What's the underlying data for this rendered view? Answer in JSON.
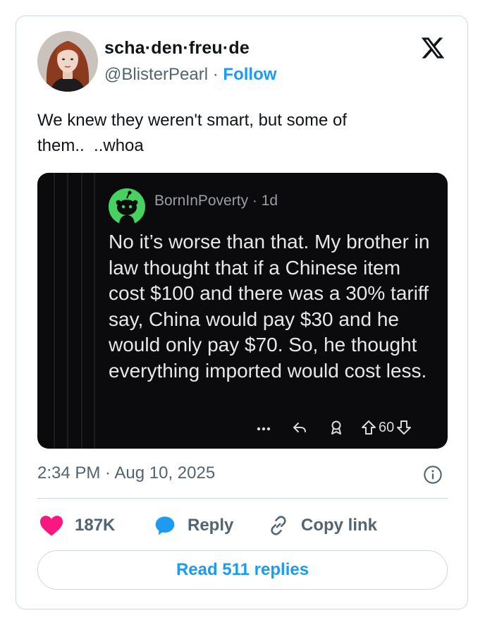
{
  "author": {
    "display_name": "scha·den·freu·de",
    "handle": "@BlisterPearl",
    "separator": "·",
    "follow_label": "Follow"
  },
  "tweet": {
    "text": "We knew they weren't smart, but some of\nthem..  ..whoa",
    "timestamp": "2:34 PM · Aug 10, 2025"
  },
  "embedded_post": {
    "username": "BornInPoverty",
    "age": "· 1d",
    "body": "No it’s worse than that. My brother in law thought that if a Chinese item cost $100 and there was a 30% tariff say, China would pay $30 and he would only pay $70. So, he thought everything imported would cost less.",
    "vote_count": "60"
  },
  "actions": {
    "likes": "187K",
    "reply_label": "Reply",
    "copy_link_label": "Copy link"
  },
  "read_replies_label": "Read 511 replies",
  "colors": {
    "accent": "#1d9bf0",
    "like": "#f91880",
    "embed_bg": "#0b0b0d",
    "reddit_green": "#46d160"
  }
}
